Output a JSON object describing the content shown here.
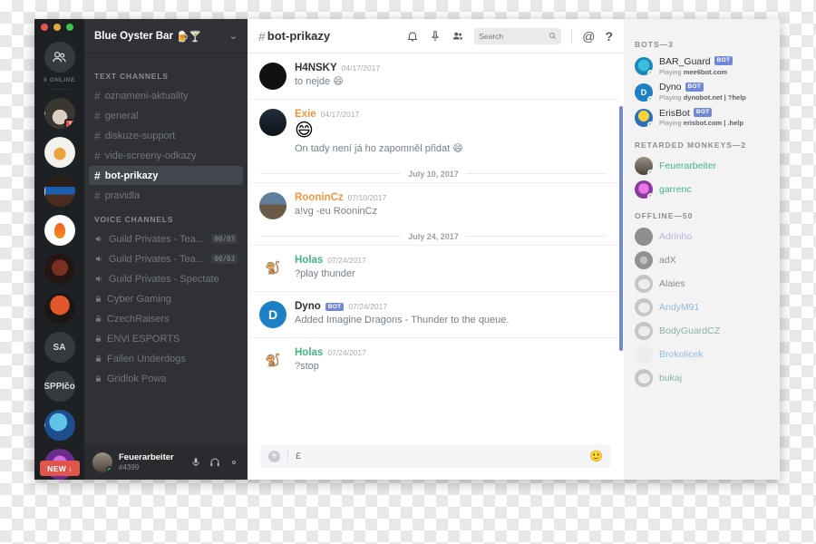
{
  "window": {
    "traffic_lights": [
      "close",
      "minimize",
      "zoom"
    ]
  },
  "server_rail": {
    "home_icon": "friends-icon",
    "online_label": "0 ONLINE",
    "servers": [
      {
        "name": "server-hat",
        "art": "av-hat",
        "badge": "1",
        "indicator": "dot"
      },
      {
        "name": "server-monkey",
        "art": "av-monkey",
        "badge": "",
        "indicator": ""
      },
      {
        "name": "server-blue-oyster-bar",
        "art": "av-neon",
        "badge": "",
        "indicator": "tall"
      },
      {
        "name": "server-flame",
        "art": "av-flame",
        "badge": "",
        "indicator": ""
      },
      {
        "name": "server-dark",
        "art": "av-dark",
        "badge": "",
        "indicator": ""
      },
      {
        "name": "server-matrix",
        "art": "av-fox",
        "badge": "",
        "indicator": ""
      },
      {
        "name": "server-sa",
        "art": "",
        "label": "SA",
        "badge": "",
        "indicator": ""
      },
      {
        "name": "server-sppico",
        "art": "",
        "label": "SPPIčo",
        "badge": "",
        "indicator": ""
      },
      {
        "name": "server-blue-art",
        "art": "av-blue",
        "badge": "",
        "indicator": "dot"
      },
      {
        "name": "server-purple-art",
        "art": "av-purple",
        "badge": "",
        "indicator": "dot"
      }
    ],
    "new_button": "NEW",
    "new_button_arrow": "↓"
  },
  "sidebar": {
    "guild_name": "Blue Oyster Bar",
    "guild_emoji": "🍺🍸",
    "chevron": "⌄",
    "text_category": "TEXT CHANNELS",
    "text_channels": [
      {
        "name": "oznameni-aktuality",
        "active": false
      },
      {
        "name": "general",
        "active": false
      },
      {
        "name": "diskuze-support",
        "active": false
      },
      {
        "name": "vide-screeny-odkazy",
        "active": false
      },
      {
        "name": "bot-prikazy",
        "active": true
      },
      {
        "name": "pravidla",
        "active": false
      }
    ],
    "voice_category": "VOICE CHANNELS",
    "voice_channels": [
      {
        "name": "Guild Privates - Tea...",
        "count": "00/03",
        "locked": false
      },
      {
        "name": "Guild Privates - Tea...",
        "count": "00/03",
        "locked": false
      },
      {
        "name": "Guild Privates - Spectate",
        "count": "",
        "locked": false
      },
      {
        "name": "Cyber Gaming",
        "count": "",
        "locked": true
      },
      {
        "name": "CzechRaisers",
        "count": "",
        "locked": true
      },
      {
        "name": "ENVi ESPORTS",
        "count": "",
        "locked": true
      },
      {
        "name": "Fallen Underdogs",
        "count": "",
        "locked": true
      },
      {
        "name": "Gridlok Powa",
        "count": "",
        "locked": true
      }
    ],
    "user_panel": {
      "username": "Feuerarbeiter",
      "discriminator": "#4399",
      "mute_icon": "microphone-icon",
      "deafen_icon": "headphones-icon",
      "settings_icon": "gear-icon"
    }
  },
  "topbar": {
    "hash": "#",
    "channel": "bot-prikazy",
    "icons": [
      "bell-icon",
      "pin-icon",
      "members-icon"
    ],
    "search_placeholder": "Search",
    "mentions_icon": "@",
    "help_icon": "?"
  },
  "chat": {
    "items": [
      {
        "kind": "message",
        "avatar": "av-hansky",
        "author": "H4NSKY",
        "author_color": "#2e3338",
        "time": "04/17/2017",
        "bot": false,
        "text": "to nejde 😄",
        "big_emoji": ""
      },
      {
        "kind": "message",
        "avatar": "av-exie",
        "author": "Exie",
        "author_color": "#f0973c",
        "time": "04/17/2017",
        "bot": false,
        "big_emoji": "😄",
        "text": "On tady není já ho zapomněl přidat 😄"
      },
      {
        "kind": "divider",
        "label": "July 10, 2017"
      },
      {
        "kind": "message",
        "avatar": "av-roonin",
        "author": "RooninCz",
        "author_color": "#f0973c",
        "time": "07/10/2017",
        "bot": false,
        "text": "a!vg -eu RooninCz",
        "big_emoji": ""
      },
      {
        "kind": "divider",
        "label": "July 24, 2017"
      },
      {
        "kind": "message",
        "avatar": "av-holas",
        "author": "Holas",
        "author_color": "#43b581",
        "time": "07/24/2017",
        "bot": false,
        "text": "?play thunder",
        "big_emoji": ""
      },
      {
        "kind": "message",
        "avatar": "av-dyno",
        "author": "Dyno",
        "author_color": "#2e3338",
        "time": "07/24/2017",
        "bot": true,
        "bot_label": "BOT",
        "text": "Added Imagine Dragons - Thunder to the queue.",
        "big_emoji": ""
      },
      {
        "kind": "message",
        "avatar": "av-holas",
        "author": "Holas",
        "author_color": "#43b581",
        "time": "07/24/2017",
        "bot": false,
        "text": "?stop",
        "big_emoji": ""
      }
    ],
    "composer": {
      "plus_icon": "+",
      "value": "£",
      "emoji_icon": "🙂"
    },
    "scrollbar_color": "#7289da"
  },
  "members": {
    "groups": [
      {
        "title": "BOTS—3",
        "people": [
          {
            "name": "BAR_Guard",
            "color": "#2e3338",
            "bot": true,
            "bot_label": "BOT",
            "status": "online",
            "avatar": "av-bar",
            "game_prefix": "Playing ",
            "game": "mee6bot.com"
          },
          {
            "name": "Dyno",
            "color": "#2e3338",
            "bot": true,
            "bot_label": "BOT",
            "status": "online",
            "avatar": "av-dyno",
            "game_prefix": "Playing ",
            "game": "dynobot.net | ?help"
          },
          {
            "name": "ErisBot",
            "color": "#2e3338",
            "bot": true,
            "bot_label": "BOT",
            "status": "online",
            "avatar": "av-eris",
            "game_prefix": "Playing ",
            "game": "erisbot.com | .help"
          }
        ]
      },
      {
        "title": "RETARDED MONKEYS—2",
        "people": [
          {
            "name": "Feuerarbeiter",
            "color": "#43b581",
            "bot": false,
            "status": "online",
            "avatar": "av-feuer",
            "game_prefix": "",
            "game": ""
          },
          {
            "name": "garrenc",
            "color": "#43b581",
            "bot": false,
            "status": "dnd",
            "avatar": "av-garrenc",
            "game_prefix": "",
            "game": ""
          }
        ]
      },
      {
        "title": "OFFLINE—50",
        "offline": true,
        "people": [
          {
            "name": "Adrinho",
            "color": "#8b7fd4",
            "bot": false,
            "status": "",
            "avatar": "av-black",
            "game": ""
          },
          {
            "name": "adX",
            "color": "#2e3338",
            "bot": false,
            "status": "",
            "avatar": "av-beard",
            "game": ""
          },
          {
            "name": "Alaies",
            "color": "#2e3338",
            "bot": false,
            "status": "",
            "avatar": "av-gen",
            "game": ""
          },
          {
            "name": "AndyM91",
            "color": "#3f8fd0",
            "bot": false,
            "status": "",
            "avatar": "av-gen",
            "game": ""
          },
          {
            "name": "BodyGuardCZ",
            "color": "#2e7d6b",
            "bot": false,
            "status": "",
            "avatar": "av-gen",
            "game": ""
          },
          {
            "name": "Brokolicek",
            "color": "#3f8fd0",
            "bot": false,
            "status": "",
            "avatar": "av-brok",
            "game": ""
          },
          {
            "name": "bukaj",
            "color": "#2e7d6b",
            "bot": false,
            "status": "",
            "avatar": "av-gen",
            "game": ""
          }
        ]
      }
    ]
  }
}
